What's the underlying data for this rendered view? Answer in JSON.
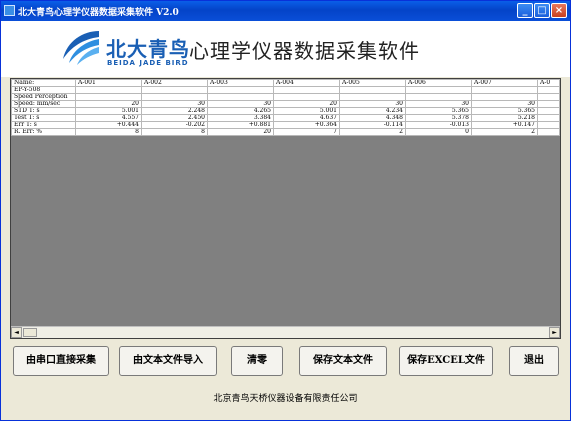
{
  "window": {
    "title": "北大青鸟心理学仪器数据采集软件 V2.0",
    "controls": {
      "minimize": "_",
      "maximize": "□",
      "close": "×"
    }
  },
  "header": {
    "brand_cn": "北大青鸟",
    "brand_en": "BEIDA JADE BIRD",
    "app_title": "心理学仪器数据采集软件"
  },
  "grid": {
    "columns": [
      "A-001",
      "A-002",
      "A-003",
      "A-004",
      "A-005",
      "A-006",
      "A-007",
      "A-0"
    ],
    "rows": [
      {
        "label": "Name:",
        "cells": [
          "A-001",
          "A-002",
          "A-003",
          "A-004",
          "A-005",
          "A-006",
          "A-007",
          "A-0"
        ]
      },
      {
        "label": "EP-Y-508",
        "cells": [
          "",
          "",
          "",
          "",
          "",
          "",
          "",
          ""
        ]
      },
      {
        "label": "Speed Perception",
        "cells": [
          "",
          "",
          "",
          "",
          "",
          "",
          "",
          ""
        ]
      },
      {
        "label": "Speed: mm/sec",
        "cells": [
          "20",
          "30",
          "30",
          "20",
          "30",
          "30",
          "30",
          ""
        ]
      },
      {
        "label": "STD T: s",
        "cells": [
          "5.001",
          "2.248",
          "4.265",
          "5.001",
          "4.234",
          "5.365",
          "5.365",
          ""
        ]
      },
      {
        "label": "Test T: s",
        "cells": [
          "4.557",
          "2.450",
          "3.384",
          "4.637",
          "4.348",
          "5.378",
          "5.218",
          ""
        ]
      },
      {
        "label": "Err T: s",
        "cells": [
          "+0.444",
          "-0.202",
          "+0.881",
          "+0.364",
          "-0.114",
          "-0.013",
          "+0.147",
          ""
        ]
      },
      {
        "label": "R. Err: %",
        "cells": [
          "8",
          "8",
          "20",
          "7",
          "2",
          "0",
          "2",
          ""
        ]
      }
    ],
    "scroll_left": "◄",
    "scroll_right": "►"
  },
  "buttons": {
    "serial": "由串口直接采集",
    "import_text": "由文本文件导入",
    "clear": "清零",
    "save_text": "保存文本文件",
    "save_excel": "保存EXCEL文件",
    "exit": "退出"
  },
  "footer": {
    "company": "北京青鸟天桥仪器设备有限责任公司"
  },
  "colors": {
    "brand": "#1a5fb4",
    "titlebar": "#0a5ee8",
    "grid_background": "#808080",
    "window": "#ece9d8"
  }
}
